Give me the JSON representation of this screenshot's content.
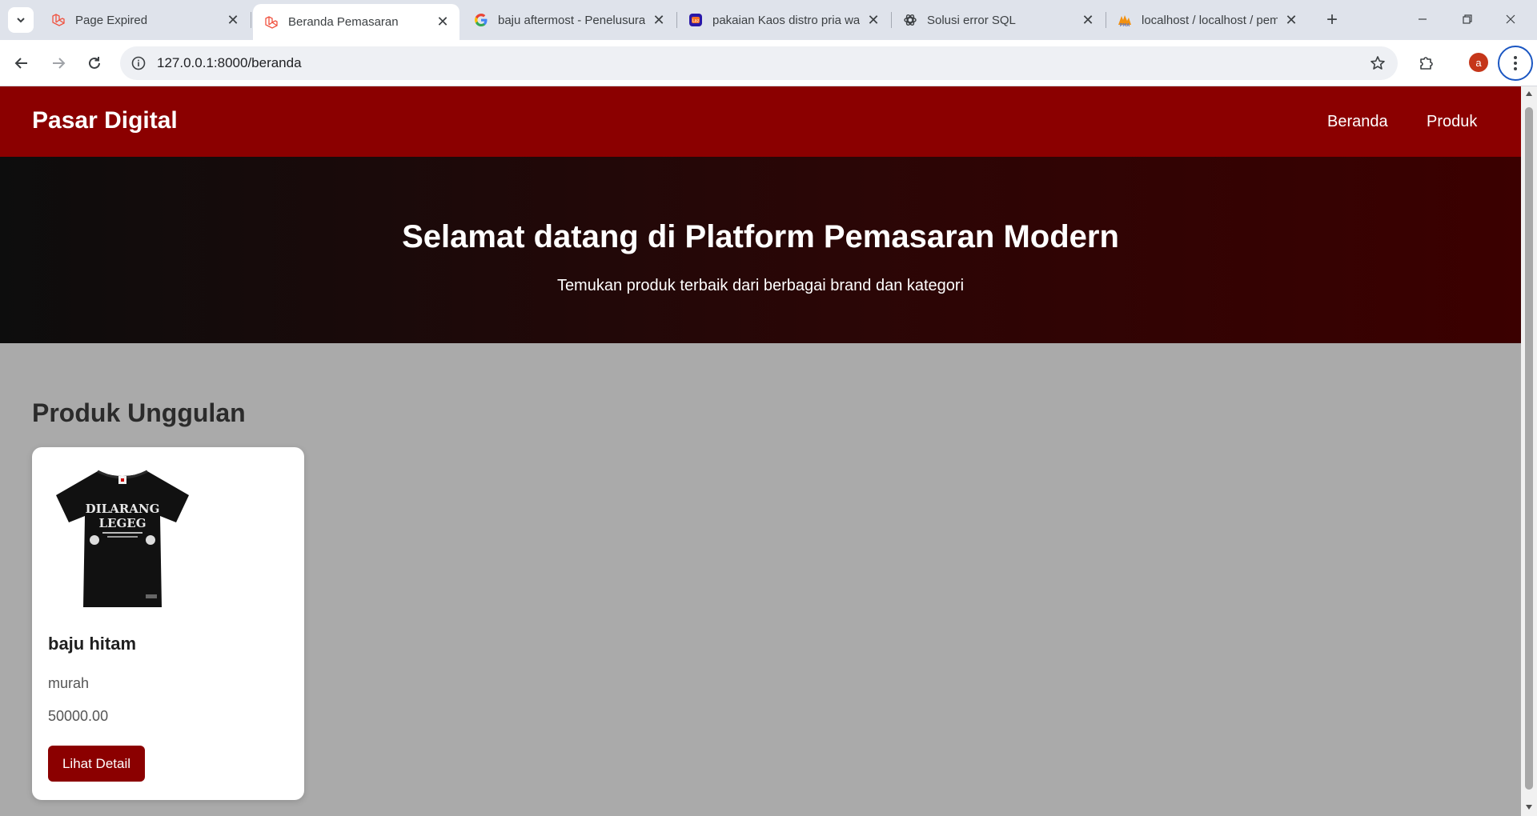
{
  "browser": {
    "tabs": [
      {
        "title": "Page Expired",
        "icon": "laravel-icon"
      },
      {
        "title": "Beranda Pemasaran",
        "icon": "laravel-icon",
        "active": true
      },
      {
        "title": "baju aftermost - Penelusuran Google",
        "icon": "google-icon"
      },
      {
        "title": "pakaian Kaos distro pria wanita",
        "icon": "lazada-icon"
      },
      {
        "title": "Solusi error SQL",
        "icon": "openai-icon"
      },
      {
        "title": "localhost / localhost / pemasaran",
        "icon": "phpmyadmin-icon"
      }
    ],
    "url": "127.0.0.1:8000/beranda",
    "profile_initial": "a"
  },
  "site": {
    "brand": "Pasar Digital",
    "nav": [
      "Beranda",
      "Produk"
    ]
  },
  "hero": {
    "title": "Selamat datang di Platform Pemasaran Modern",
    "subtitle": "Temukan produk terbaik dari berbagai brand dan kategori"
  },
  "featured": {
    "heading": "Produk Unggulan",
    "products": [
      {
        "name": "baju hitam",
        "description": "murah",
        "price": "50000.00",
        "button": "Lihat Detail",
        "image": "black-tshirt-image",
        "print_text_1": "DILARANG",
        "print_text_2": "LEGEG"
      }
    ]
  },
  "colors": {
    "brand_red": "#8b0000",
    "page_bg": "#aaaaaa"
  }
}
